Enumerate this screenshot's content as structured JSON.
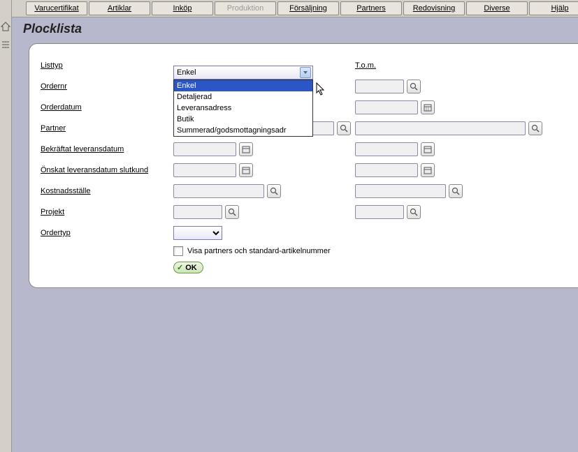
{
  "nav": {
    "tabs": [
      "Varucertifikat",
      "Artiklar",
      "Inköp",
      "Produktion",
      "Försäljning",
      "Partners",
      "Redovisning",
      "Diverse",
      "Hjälp"
    ],
    "disabled_index": 3
  },
  "page": {
    "title": "Plocklista"
  },
  "labels": {
    "listtyp": "Listtyp",
    "tom": "T.o.m.",
    "ordernr": "Ordernr",
    "orderdatum": "Orderdatum",
    "partner": "Partner",
    "bekraftat": "Bekräftat leveransdatum",
    "onskat": "Önskat leveransdatum slutkund",
    "kostnad": "Kostnadsställe",
    "projekt": "Projekt",
    "ordertyp": "Ordertyp",
    "visa_partners": "Visa partners och standard-artikelnummer",
    "ok": "OK"
  },
  "listtyp": {
    "selected": "Enkel",
    "options": [
      "Enkel",
      "Detaljerad",
      "Leveransadress",
      "Butik",
      "Summerad/godsmottagningsadr"
    ]
  }
}
